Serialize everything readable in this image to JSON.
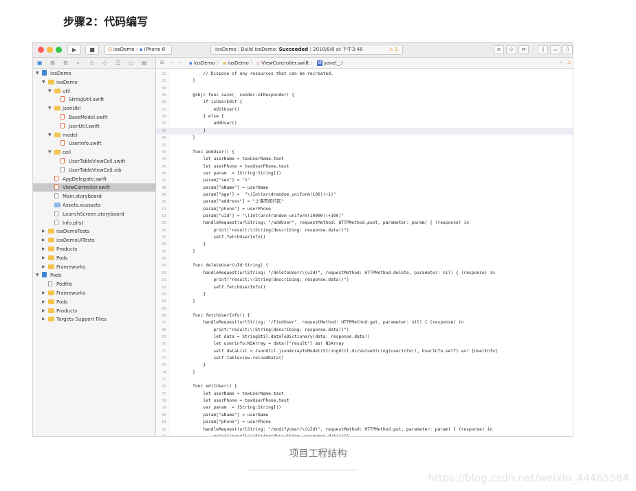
{
  "article": {
    "heading": "步骤2：代码编写",
    "caption": "项目工程结构",
    "watermark": "https://blog.csdn.net/weixin_44465584"
  },
  "toolbar": {
    "traffic_light_colors": [
      "#fc605c",
      "#fdbc40",
      "#34c84a"
    ],
    "run_icon": "play-icon",
    "stop_icon": "stop-icon",
    "scheme_name": "iosDemo",
    "device_name": "iPhone 6",
    "status_project": "iosDemo",
    "status_build_prefix": "Build iosDemo:",
    "status_build_result": "Succeeded",
    "status_time": "2018/8/6 at 下午3:48",
    "warning_count": "1"
  },
  "jumpbar": {
    "crumbs": [
      "iosDemo",
      "iosDemo",
      "ViewController.swift",
      "save(_:)"
    ]
  },
  "tree": [
    {
      "label": "iosDemo",
      "depth": 0,
      "icon": "project-icon",
      "open": true
    },
    {
      "label": "iosDemo",
      "depth": 1,
      "icon": "folder-icon",
      "open": true
    },
    {
      "label": "util",
      "depth": 2,
      "icon": "folder-icon",
      "open": true
    },
    {
      "label": "StringUtil.swift",
      "depth": 3,
      "icon": "swift-file-icon"
    },
    {
      "label": "JsonUtil",
      "depth": 2,
      "icon": "folder-icon",
      "open": true
    },
    {
      "label": "BaseModel.swift",
      "depth": 3,
      "icon": "swift-file-icon"
    },
    {
      "label": "JsonUtil.swift",
      "depth": 3,
      "icon": "swift-file-icon"
    },
    {
      "label": "model",
      "depth": 2,
      "icon": "folder-icon",
      "open": true
    },
    {
      "label": "Userinfo.swift",
      "depth": 3,
      "icon": "swift-file-icon"
    },
    {
      "label": "cell",
      "depth": 2,
      "icon": "folder-icon",
      "open": true
    },
    {
      "label": "UserTableViewCell.swift",
      "depth": 3,
      "icon": "swift-file-icon"
    },
    {
      "label": "UserTableViewCell.xib",
      "depth": 3,
      "icon": "doc-icon"
    },
    {
      "label": "AppDelegate.swift",
      "depth": 2,
      "icon": "swift-file-icon"
    },
    {
      "label": "ViewController.swift",
      "depth": 2,
      "icon": "swift-file-icon",
      "selected": true
    },
    {
      "label": "Main.storyboard",
      "depth": 2,
      "icon": "doc-icon"
    },
    {
      "label": "Assets.xcassets",
      "depth": 2,
      "icon": "assets-icon"
    },
    {
      "label": "LaunchScreen.storyboard",
      "depth": 2,
      "icon": "doc-icon"
    },
    {
      "label": "Info.plist",
      "depth": 2,
      "icon": "doc-icon"
    },
    {
      "label": "iosDemoTests",
      "depth": 1,
      "icon": "folder-icon",
      "open": false
    },
    {
      "label": "iosDemoUITests",
      "depth": 1,
      "icon": "folder-icon",
      "open": false
    },
    {
      "label": "Products",
      "depth": 1,
      "icon": "folder-icon",
      "open": false
    },
    {
      "label": "Pods",
      "depth": 1,
      "icon": "folder-icon",
      "open": false
    },
    {
      "label": "Frameworks",
      "depth": 1,
      "icon": "folder-icon",
      "open": false
    },
    {
      "label": "Pods",
      "depth": 0,
      "icon": "project-icon",
      "open": true
    },
    {
      "label": "Podfile",
      "depth": 1,
      "icon": "doc-icon"
    },
    {
      "label": "Frameworks",
      "depth": 1,
      "icon": "folder-icon",
      "open": false
    },
    {
      "label": "Pods",
      "depth": 1,
      "icon": "folder-icon",
      "open": false
    },
    {
      "label": "Products",
      "depth": 1,
      "icon": "folder-icon",
      "open": false
    },
    {
      "label": "Targets Support Files",
      "depth": 1,
      "icon": "folder-icon",
      "open": false
    }
  ],
  "editor": {
    "current_line": "40",
    "lines": [
      {
        "n": "32",
        "text": "        // Dispose of any resources that can be recreated."
      },
      {
        "n": "33",
        "text": "    }"
      },
      {
        "n": "34",
        "text": ""
      },
      {
        "n": "35",
        "text": "    @objc func save(_ sender:UIResponder) {"
      },
      {
        "n": "36",
        "text": "        if isUserEdit {"
      },
      {
        "n": "37",
        "text": "            editUser()"
      },
      {
        "n": "38",
        "text": "        } else {"
      },
      {
        "n": "39",
        "text": "            addUser()"
      },
      {
        "n": "40",
        "text": "        }"
      },
      {
        "n": "41",
        "text": "    }"
      },
      {
        "n": "42",
        "text": ""
      },
      {
        "n": "43",
        "text": "    func addUser() {"
      },
      {
        "n": "44",
        "text": "        let userName = texUserName.text"
      },
      {
        "n": "45",
        "text": "        let userPhone = texUserPhone.text"
      },
      {
        "n": "46",
        "text": "        var param  = [String:String]()"
      },
      {
        "n": "47",
        "text": "        param[\"sex\"] = \"1\""
      },
      {
        "n": "48",
        "text": "        param[\"aName\"] = userName"
      },
      {
        "n": "49",
        "text": "        param[\"age\"] =  \"\\(Int(arc4random_uniform(100))+1)\""
      },
      {
        "n": "50",
        "text": "        param[\"address\"] = \"上海市闵行区\""
      },
      {
        "n": "51",
        "text": "        param[\"phone\"] = userPhone"
      },
      {
        "n": "52",
        "text": "        param[\"uId\"] = \"\\(Int(arc4random_uniform(10000))+100)\""
      },
      {
        "n": "53",
        "text": "        handleRequest(urlString: \"/addUser\", requestMethod: HTTPMethod.post, parameter: param) { (response) in"
      },
      {
        "n": "54",
        "text": "            print(\"result:\\(String(describing: response.data))\")"
      },
      {
        "n": "55",
        "text": "            self.fetchUserInfo()"
      },
      {
        "n": "56",
        "text": "        }"
      },
      {
        "n": "57",
        "text": "    }"
      },
      {
        "n": "58",
        "text": ""
      },
      {
        "n": "59",
        "text": "    func deleteUser(uId:String) {"
      },
      {
        "n": "60",
        "text": "        handleRequest(urlString: \"/deleteUser/\\(uId)\", requestMethod: HTTPMethod.delete, parameter: nil) { (response) in"
      },
      {
        "n": "61",
        "text": "            print(\"result:\\(String(describing: response.data))\")"
      },
      {
        "n": "62",
        "text": "            self.fetchUserInfo()"
      },
      {
        "n": "63",
        "text": "        }"
      },
      {
        "n": "64",
        "text": "    }"
      },
      {
        "n": "65",
        "text": ""
      },
      {
        "n": "66",
        "text": "    func fetchUserInfo() {"
      },
      {
        "n": "67",
        "text": "        handleRequest(urlString: \"/findUser\", requestMethod: HTTPMethod.get, parameter: nil) { (response) in"
      },
      {
        "n": "68",
        "text": "            print(\"result:\\(String(describing: response.data))\")"
      },
      {
        "n": "69",
        "text": "            let data = StringUtil.dataToDictionary(data: response.data!)"
      },
      {
        "n": "70",
        "text": "            let userinfo:NSArray = data![\"result\"] as! NSArray"
      },
      {
        "n": "71",
        "text": "            self.dataList = JsonUtil.jsonArrayToModel(StringUtil.dicValueString(userinfo)!, UserInfo.self) as! [UserInfo]"
      },
      {
        "n": "72",
        "text": "            self.tableview.reloadData()"
      },
      {
        "n": "73",
        "text": "        }"
      },
      {
        "n": "74",
        "text": "    }"
      },
      {
        "n": "75",
        "text": ""
      },
      {
        "n": "76",
        "text": "    func editUser() {"
      },
      {
        "n": "77",
        "text": "        let userName = texUserName.text"
      },
      {
        "n": "78",
        "text": "        let userPhone = texUserPhone.text"
      },
      {
        "n": "79",
        "text": "        var param  = [String:String]()"
      },
      {
        "n": "80",
        "text": "        param[\"aName\"] = userName"
      },
      {
        "n": "81",
        "text": "        param[\"phone\"] = userPhone"
      },
      {
        "n": "82",
        "text": "        handleRequest(urlString: \"/modifyUser/\\(uId)\", requestMethod: HTTPMethod.put, parameter: param) { (response) in"
      },
      {
        "n": "83",
        "text": "            print(\"result:\\(String(describing: response.data))\")"
      }
    ]
  }
}
